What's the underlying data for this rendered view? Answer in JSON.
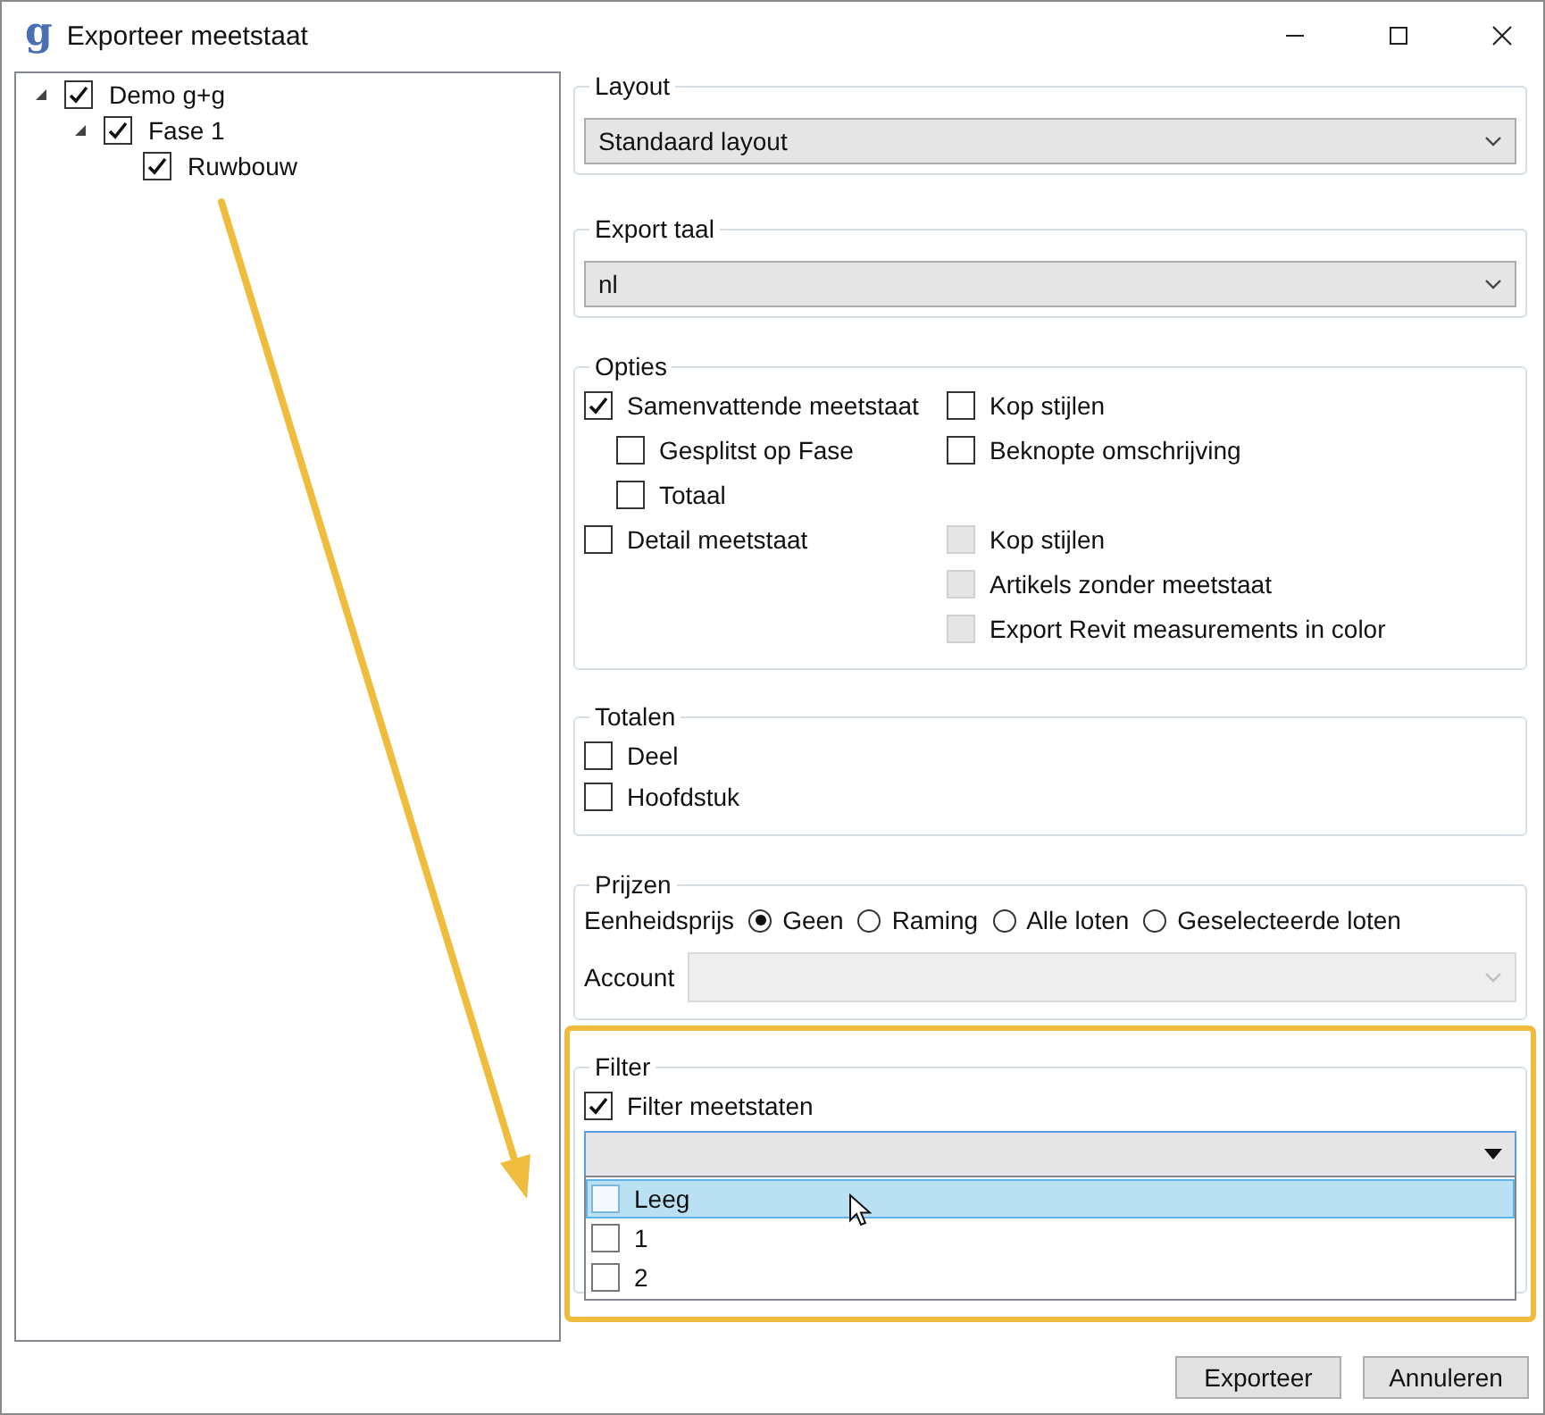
{
  "window": {
    "logo": "g",
    "title": "Exporteer meetstaat"
  },
  "tree": [
    {
      "label": "Demo g+g",
      "checked": true,
      "expanded": true,
      "children": [
        {
          "label": "Fase 1",
          "checked": true,
          "expanded": true,
          "children": [
            {
              "label": "Ruwbouw",
              "checked": true
            }
          ]
        }
      ]
    }
  ],
  "layout": {
    "title": "Layout",
    "value": "Standaard layout"
  },
  "export_language": {
    "title": "Export taal",
    "value": "nl"
  },
  "options": {
    "title": "Opties",
    "groups": [
      {
        "main": {
          "label": "Samenvattende meetstaat",
          "checked": true,
          "disabled": false,
          "children": [
            {
              "label": "Gesplitst op Fase",
              "checked": false,
              "disabled": false
            },
            {
              "label": "Totaal",
              "checked": false,
              "disabled": false
            }
          ]
        },
        "extras": [
          {
            "label": "Kop stijlen",
            "checked": false,
            "disabled": false
          },
          {
            "label": "Beknopte omschrijving",
            "checked": false,
            "disabled": false
          }
        ]
      },
      {
        "main": {
          "label": "Detail meetstaat",
          "checked": false,
          "disabled": false
        },
        "extras": [
          {
            "label": "Kop stijlen",
            "checked": false,
            "disabled": true
          },
          {
            "label": "Artikels zonder meetstaat",
            "checked": false,
            "disabled": true
          },
          {
            "label": "Export Revit measurements in color",
            "checked": false,
            "disabled": true
          }
        ]
      }
    ]
  },
  "totals": {
    "title": "Totalen",
    "items": [
      {
        "label": "Deel",
        "checked": false
      },
      {
        "label": "Hoofdstuk",
        "checked": false
      }
    ]
  },
  "prices": {
    "title": "Prijzen",
    "unit_price_label": "Eenheidsprijs",
    "choices": [
      {
        "label": "Geen",
        "selected": true
      },
      {
        "label": "Raming",
        "selected": false
      },
      {
        "label": "Alle loten",
        "selected": false
      },
      {
        "label": "Geselecteerde loten",
        "selected": false
      }
    ],
    "account": {
      "label": "Account",
      "disabled": true
    }
  },
  "filter": {
    "title": "Filter",
    "checkbox": {
      "label": "Filter meetstaten",
      "checked": true
    },
    "dropdown": {
      "expanded": true,
      "items": [
        {
          "label": "Leeg",
          "checked": false,
          "selected": true
        },
        {
          "label": "1",
          "checked": false,
          "selected": false
        },
        {
          "label": "2",
          "checked": false,
          "selected": false
        }
      ]
    }
  },
  "buttons": [
    "Exporteer",
    "Annuleren"
  ]
}
